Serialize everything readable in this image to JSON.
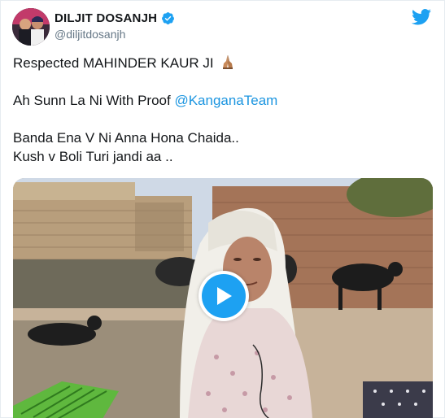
{
  "tweet": {
    "author": {
      "display_name": "DILJIT DOSANJH",
      "handle": "@diljitdosanjh",
      "verified": true,
      "avatar_icon": "user-avatar"
    },
    "brand_icon": "twitter-bird-icon",
    "text": {
      "line1": "Respected MAHINDER KAUR JI",
      "line1_emoji": "folded-hands-emoji",
      "line2_prefix": "Ah Sunn La Ni With Proof ",
      "line2_mention": "@KanganaTeam",
      "line3": "Banda Ena V Ni Anna Hona Chaida..",
      "line4": "Kush v Boli Turi jandi aa .."
    },
    "media": {
      "type": "video",
      "play_icon": "play-icon"
    }
  },
  "colors": {
    "brand_blue": "#1da1f2",
    "mention_blue": "#1b95e0",
    "text": "#14171a",
    "muted": "#657786",
    "border": "#e6ecf0"
  }
}
